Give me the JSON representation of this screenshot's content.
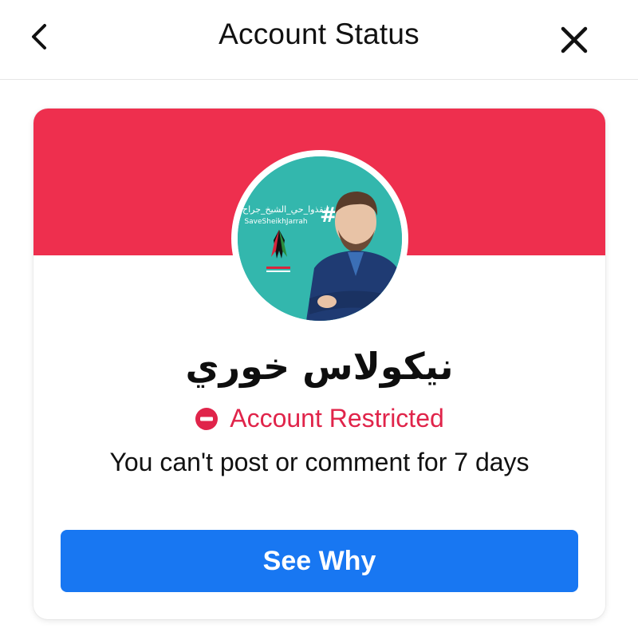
{
  "header": {
    "title": "Account Status"
  },
  "profile": {
    "name": "نيكولاس خوري",
    "avatar_overlay": {
      "arabic_tag": "انقذوا_حي_الشيخ_جراح",
      "english_tag": "SaveSheikhJarrah"
    }
  },
  "status": {
    "label": "Account Restricted",
    "description": "You can't post or comment for 7 days"
  },
  "actions": {
    "see_why_label": "See Why"
  },
  "colors": {
    "banner": "#ee2f4e",
    "status_red": "#e0244a",
    "primary_button": "#1877f2",
    "avatar_bg": "#33b7ad"
  },
  "icons": {
    "back": "chevron-left-icon",
    "close": "close-icon",
    "status": "restricted-icon"
  }
}
